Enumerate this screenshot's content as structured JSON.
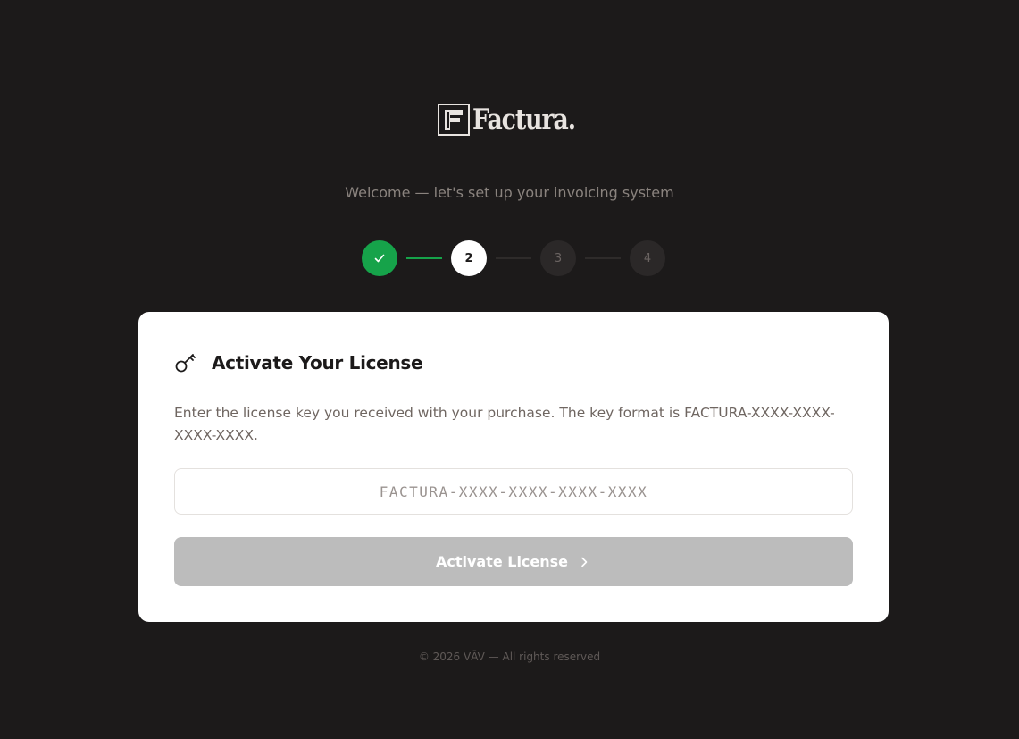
{
  "brand": {
    "name": "Factura.",
    "icon": "factura-logo-icon"
  },
  "subtitle": "Welcome — let's set up your invoicing system",
  "stepper": {
    "current_step": 2,
    "steps": [
      {
        "label": "",
        "status": "done",
        "icon": "check-icon"
      },
      {
        "label": "2",
        "status": "current"
      },
      {
        "label": "3",
        "status": "pending"
      },
      {
        "label": "4",
        "status": "pending"
      }
    ]
  },
  "card": {
    "icon": "key-icon",
    "title": "Activate Your License",
    "description": "Enter the license key you received with your purchase. The key format is FACTURA-XXXX-XXXX-XXXX-XXXX.",
    "input": {
      "value": "",
      "placeholder": "FACTURA-XXXX-XXXX-XXXX-XXXX"
    },
    "button": {
      "label": "Activate License",
      "icon": "chevron-right-icon",
      "enabled": false
    }
  },
  "footer": "© 2026 VĀV — All rights reserved",
  "colors": {
    "background": "#1c1a1a",
    "accent_done": "#16a34a",
    "button_disabled": "#bcbcbc",
    "card": "#ffffff"
  }
}
